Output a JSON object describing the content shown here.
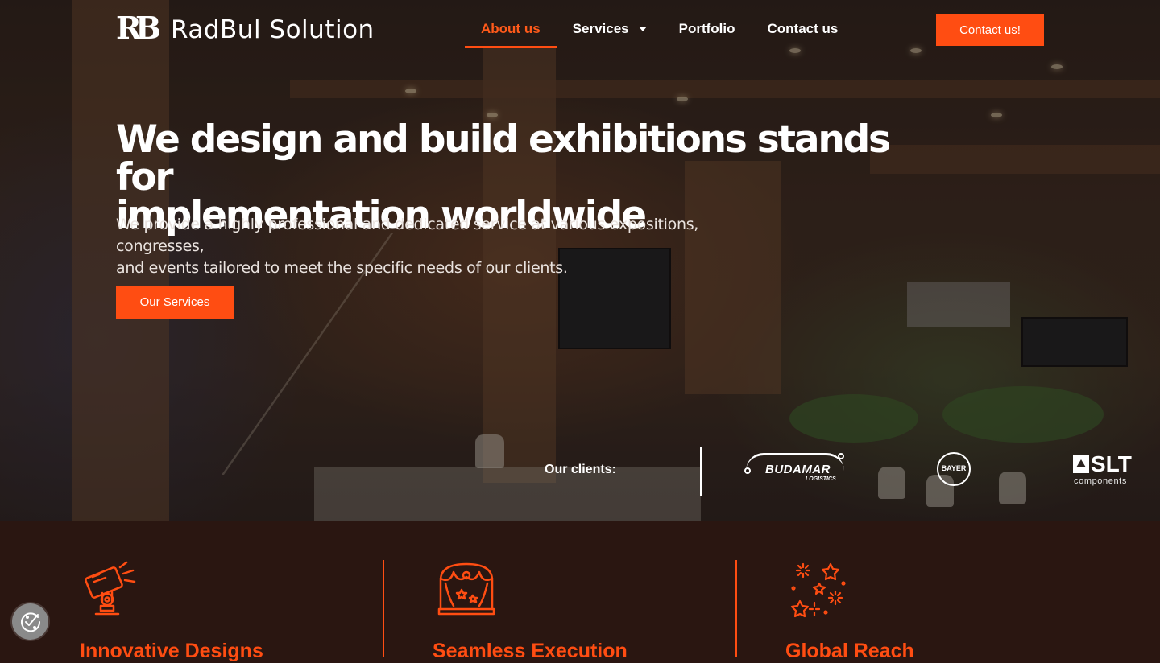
{
  "brand": {
    "name": "RadBul Solution",
    "mark": "RB"
  },
  "nav": {
    "items": [
      {
        "label": "About us",
        "active": true
      },
      {
        "label": "Services",
        "has_dropdown": true
      },
      {
        "label": "Portfolio"
      },
      {
        "label": "Contact us"
      }
    ],
    "cta": "Contact us!"
  },
  "hero": {
    "headline_line1": "We design and build exhibitions stands for",
    "headline_line2": "implementation worldwide",
    "subtext_line1": "We provide a highly professional and dedicated service at various expositions, congresses,",
    "subtext_line2": "and events tailored to meet the specific needs of our clients.",
    "button": "Our Services"
  },
  "clients": {
    "label": "Our clients:",
    "logos": [
      {
        "name": "BUDAMAR",
        "sub": "LOGISTICS"
      },
      {
        "name": "BAYER"
      },
      {
        "name": "SLT",
        "sub": "components"
      }
    ]
  },
  "features": [
    {
      "title": "Innovative Designs",
      "icon": "spotlight-icon"
    },
    {
      "title": "Seamless Execution",
      "icon": "stage-curtain-icon"
    },
    {
      "title": "Global Reach",
      "icon": "fireworks-icon"
    }
  ],
  "colors": {
    "accent": "#ff4d12",
    "dark_bg": "#2a1611"
  },
  "cookie": {
    "icon": "cookie-consent-icon"
  }
}
